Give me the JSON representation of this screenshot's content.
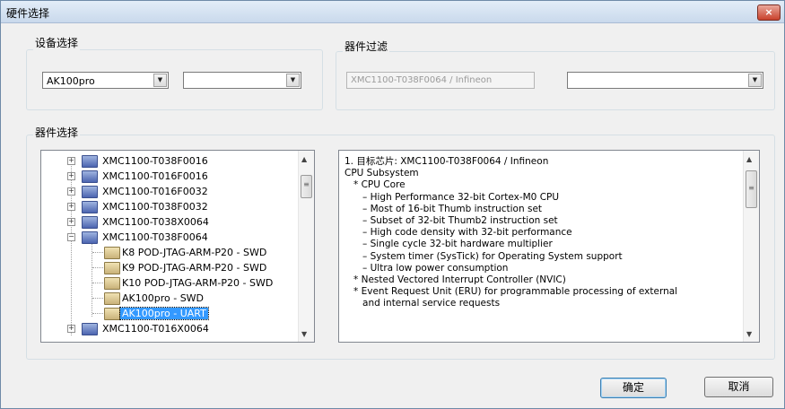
{
  "window": {
    "title": "硬件选择",
    "close_glyph": "×"
  },
  "device_group": {
    "label": "设备选择",
    "device_combo": {
      "value": "AK100pro",
      "arrow": "▼"
    },
    "second_combo": {
      "value": "",
      "arrow": "▼"
    }
  },
  "filter_group": {
    "label": "器件过滤",
    "filter_text": "XMC1100-T038F0064 / Infineon",
    "filter_combo": {
      "value": "",
      "arrow": "▼"
    }
  },
  "selection_group": {
    "label": "器件选择",
    "tree": [
      {
        "label": "XMC1100-T038F0016",
        "expander": "+"
      },
      {
        "label": "XMC1100-T016F0016",
        "expander": "+"
      },
      {
        "label": "XMC1100-T016F0032",
        "expander": "+"
      },
      {
        "label": "XMC1100-T038F0032",
        "expander": "+"
      },
      {
        "label": "XMC1100-T038X0064",
        "expander": "+"
      },
      {
        "label": "XMC1100-T038F0064",
        "expander": "−",
        "children": [
          {
            "label": "K8  POD-JTAG-ARM-P20  - SWD"
          },
          {
            "label": "K9  POD-JTAG-ARM-P20  - SWD"
          },
          {
            "label": "K10  POD-JTAG-ARM-P20  - SWD"
          },
          {
            "label": "AK100pro    - SWD"
          },
          {
            "label": "AK100pro    - UART",
            "selected": true
          }
        ]
      },
      {
        "label": "XMC1100-T016X0064",
        "expander": "+"
      }
    ],
    "description": [
      "1. 目标芯片: XMC1100-T038F0064 / Infineon",
      "",
      "CPU Subsystem",
      "   * CPU Core",
      "      – High Performance 32-bit Cortex-M0 CPU",
      "      – Most of 16-bit Thumb instruction set",
      "      – Subset of 32-bit Thumb2 instruction set",
      "      – High code density with 32-bit performance",
      "      – Single cycle 32-bit hardware multiplier",
      "      – System timer (SysTick) for Operating System support",
      "      – Ultra low power consumption",
      "   * Nested Vectored Interrupt Controller (NVIC)",
      "   * Event Request Unit (ERU) for programmable processing of external",
      "      and internal service requests"
    ]
  },
  "scrollbar": {
    "up": "▲",
    "down": "▼",
    "grip": "≡"
  },
  "buttons": {
    "ok": "确定",
    "cancel": "取消"
  }
}
